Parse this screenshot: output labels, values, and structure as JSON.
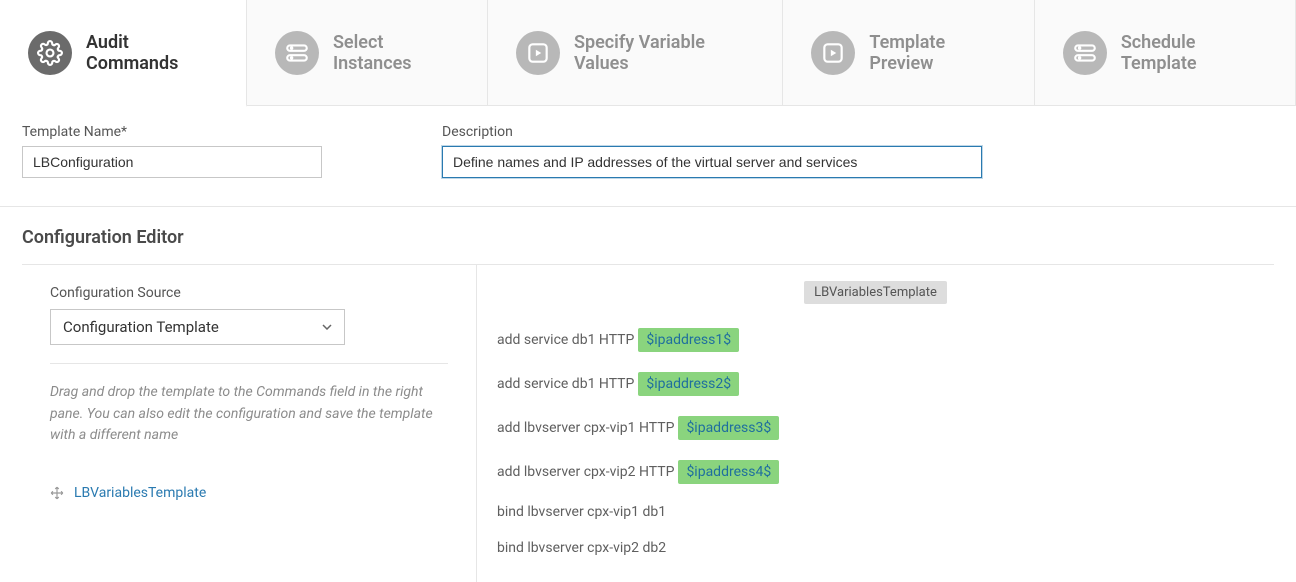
{
  "steps": [
    {
      "label": "Audit Commands"
    },
    {
      "label": "Select Instances"
    },
    {
      "label": "Specify Variable Values"
    },
    {
      "label": "Template Preview"
    },
    {
      "label": "Schedule Template"
    }
  ],
  "form": {
    "template_name_label": "Template Name*",
    "template_name_value": "LBConfiguration",
    "description_label": "Description",
    "description_value": "Define names and IP addresses of the virtual server and services"
  },
  "editor": {
    "title": "Configuration Editor",
    "config_source_label": "Configuration Source",
    "config_source_value": "Configuration Template",
    "help_text": "Drag and drop the template to the Commands field in the right pane. You can also edit the configuration and save the template with a different name",
    "template_item": "LBVariablesTemplate",
    "badge": "LBVariablesTemplate",
    "commands": [
      {
        "prefix": "add service db1 HTTP ",
        "var": "$ipaddress1$"
      },
      {
        "prefix": "add service db1 HTTP ",
        "var": "$ipaddress2$"
      },
      {
        "prefix": "add lbvserver cpx-vip1 HTTP ",
        "var": "$ipaddress3$"
      },
      {
        "prefix": "add lbvserver cpx-vip2 HTTP ",
        "var": "$ipaddress4$"
      },
      {
        "prefix": "bind lbvserver cpx-vip1 db1"
      },
      {
        "prefix": "bind lbvserver cpx-vip2 db2"
      }
    ]
  }
}
